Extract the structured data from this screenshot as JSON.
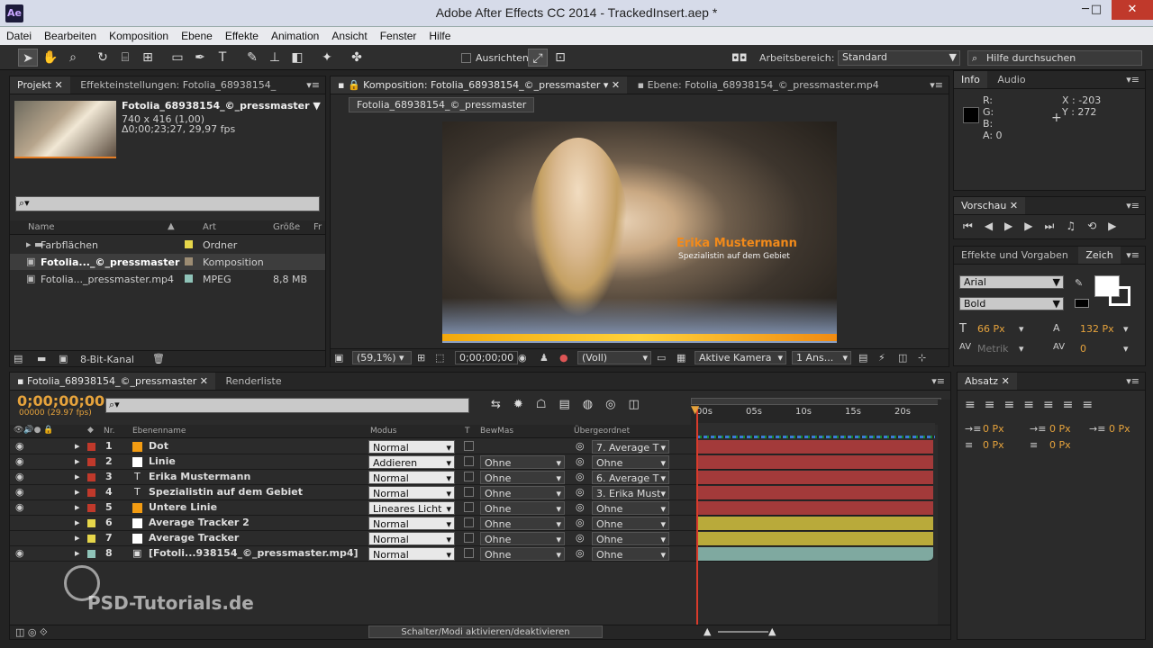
{
  "window": {
    "title": "Adobe After Effects CC 2014 - TrackedInsert.aep *",
    "app_icon": "Ae"
  },
  "menu": [
    "Datei",
    "Bearbeiten",
    "Komposition",
    "Ebene",
    "Effekte",
    "Animation",
    "Ansicht",
    "Fenster",
    "Hilfe"
  ],
  "toolbar": {
    "align_label": "Ausrichten",
    "workspace_label": "Arbeitsbereich:",
    "workspace_value": "Standard",
    "search_placeholder": "Hilfe durchsuchen"
  },
  "project": {
    "tab": "Projekt",
    "tab2": "Effekteinstellungen: Fotolia_68938154_",
    "name": "Fotolia_68938154_©_pressmaster ▼",
    "size": "740 x 416 (1,00)",
    "duration": "Δ0;00;23;27, 29,97 fps",
    "cols": {
      "name": "Name",
      "type": "Art",
      "size": "Größe",
      "fr": "Fr"
    },
    "items": [
      {
        "name": "Farbflächen",
        "type": "Ordner",
        "size": "",
        "color": "#e6d64a"
      },
      {
        "name": "Fotolia..._©_pressmaster",
        "type": "Komposition",
        "size": "",
        "color": "#9c8c73"
      },
      {
        "name": "Fotolia..._pressmaster.mp4",
        "type": "MPEG",
        "size": "8,8 MB",
        "color": "#8fc3b8"
      }
    ],
    "bitdepth": "8-Bit-Kanal"
  },
  "comp": {
    "tab": "Komposition: Fotolia_68938154_©_pressmaster",
    "tab2": "Ebene: Fotolia_68938154_©_pressmaster.mp4",
    "breadcrumb": "Fotolia_68938154_©_pressmaster",
    "lower_third_name": "Erika Mustermann",
    "lower_third_sub": "Spezialistin auf dem Gebiet",
    "zoom": "(59,1%)",
    "time": "0;00;00;00",
    "quality": "(Voll)",
    "camera": "Aktive Kamera",
    "views": "1 Ans..."
  },
  "info": {
    "tab": "Info",
    "tab2": "Audio",
    "r": "R:",
    "g": "G:",
    "b": "B:",
    "a": "A:  0",
    "x": "X : -203",
    "y": "Y : 272"
  },
  "preview": {
    "tab": "Vorschau"
  },
  "effects": {
    "tab": "Effekte und Vorgaben",
    "tab2": "Zeich"
  },
  "char": {
    "font": "Arial",
    "style": "Bold",
    "size": "66 Px",
    "leading": "132 Px",
    "kerning": "Metrik",
    "tracking": "0"
  },
  "para": {
    "tab": "Absatz",
    "a": "0 Px",
    "b": "0 Px",
    "c": "0 Px",
    "d": "0 Px",
    "e": "0 Px"
  },
  "timeline": {
    "tab": "Fotolia_68938154_©_pressmaster",
    "tab2": "Renderliste",
    "timecode": "0;00;00;00",
    "fps": "00000 (29.97 fps)",
    "cols": {
      "nr": "Nr.",
      "name": "Ebenenname",
      "mode": "Modus",
      "t": "T",
      "trk": "BewMas",
      "parent": "Übergeordnet"
    },
    "ruler": [
      "00s",
      "05s",
      "10s",
      "15s",
      "20s"
    ],
    "layers": [
      {
        "nr": "1",
        "name": "Dot",
        "mode": "Normal",
        "trk": "",
        "parent": "7. Average T",
        "color": "#f39c12",
        "label": "#c0392b",
        "bar": "#a33a3a",
        "type": "solid"
      },
      {
        "nr": "2",
        "name": "Linie",
        "mode": "Addieren",
        "trk": "Ohne",
        "parent": "Ohne",
        "color": "#ffffff",
        "label": "#c0392b",
        "bar": "#a33a3a",
        "type": "solid"
      },
      {
        "nr": "3",
        "name": "Erika Mustermann",
        "mode": "Normal",
        "trk": "Ohne",
        "parent": "6. Average T",
        "color": "",
        "label": "#c0392b",
        "bar": "#a33a3a",
        "type": "text"
      },
      {
        "nr": "4",
        "name": "Spezialistin auf dem Gebiet",
        "mode": "Normal",
        "trk": "Ohne",
        "parent": "3. Erika Must",
        "color": "",
        "label": "#c0392b",
        "bar": "#a33a3a",
        "type": "text"
      },
      {
        "nr": "5",
        "name": "Untere Linie",
        "mode": "Lineares Licht",
        "trk": "Ohne",
        "parent": "Ohne",
        "color": "#f39c12",
        "label": "#c0392b",
        "bar": "#a33a3a",
        "type": "solid"
      },
      {
        "nr": "6",
        "name": "Average Tracker 2",
        "mode": "Normal",
        "trk": "Ohne",
        "parent": "Ohne",
        "color": "#ffffff",
        "label": "#e6d64a",
        "bar": "#b9aa3a",
        "type": "solid"
      },
      {
        "nr": "7",
        "name": "Average Tracker",
        "mode": "Normal",
        "trk": "Ohne",
        "parent": "Ohne",
        "color": "#ffffff",
        "label": "#e6d64a",
        "bar": "#b9aa3a",
        "type": "solid"
      },
      {
        "nr": "8",
        "name": "[Fotoli...938154_©_pressmaster.mp4]",
        "mode": "Normal",
        "trk": "Ohne",
        "parent": "Ohne",
        "color": "",
        "label": "#8fc3b8",
        "bar": "#7fa9a0",
        "type": "footage"
      }
    ],
    "toggle_label": "Schalter/Modi aktivieren/deaktivieren"
  },
  "watermark": "PSD-Tutorials.de"
}
